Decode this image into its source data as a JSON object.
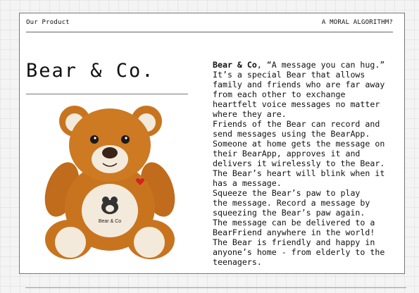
{
  "header": {
    "left": "Our Product",
    "right": "A MORAL ALGORITHM?"
  },
  "product": {
    "name": "Bear & Co.",
    "image_logo_text": "Bear & Co"
  },
  "description": {
    "brand": "Bear & Co",
    "p1": ", “A message you can hug.”\nIt’s a special Bear that allows\nfamily and friends who are far away\nfrom each other to exchange\nheartfelt voice messages no matter\nwhere they are.",
    "p2": "Friends of the Bear can record and\nsend messages using the BearApp.\nSomeone at home gets the message on\ntheir BearApp, approves it and\ndelivers it wirelessly to the Bear.\nThe Bear’s heart will blink when it\nhas a message.",
    "p3": "Squeeze the Bear’s paw to play\nthe message. Record a message by\nsqueezing the Bear’s paw again.\nThe message can be delivered to a\nBearFriend anywhere in the world!\nThe Bear is friendly and happy in\nanyone’s home - from elderly to the\nteenagers."
  },
  "colors": {
    "bear_fur": "#c8741f",
    "bear_belly": "#f4eadb",
    "heart": "#d3221f"
  }
}
